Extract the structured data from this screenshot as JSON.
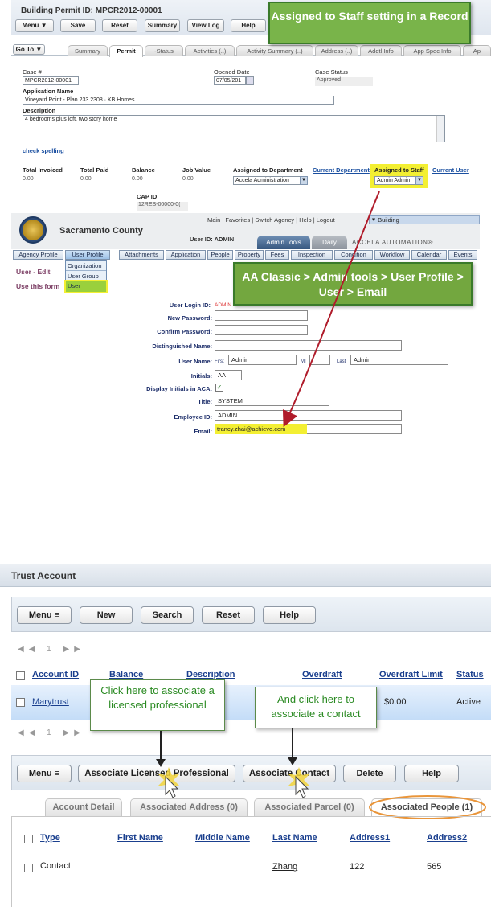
{
  "record": {
    "permit_id": "Building Permit ID: MPCR2012-00001",
    "buttons": [
      "Menu ▼",
      "Save",
      "Reset",
      "Summary",
      "View Log",
      "Help"
    ],
    "goto": "Go To ▼",
    "tabs": [
      "Summary",
      "Permit",
      "-Status",
      "Activities (..)",
      "Activity Summary (..)",
      "Address (..)",
      "Addtl Info",
      "App Spec Info",
      "Ap"
    ],
    "case_label": "Case #",
    "case_value": "MPCR2012-00001",
    "opened_label": "Opened Date",
    "opened_value": "07/05/201",
    "status_label": "Case Status",
    "status_value": "Approved",
    "appname_label": "Application Name",
    "appname_value": "Vineyard Point - Plan 233.2308 · KB Homes",
    "desc_label": "Description",
    "desc_value": "4 bedrooms plus loft, two story home",
    "spell": "check spelling",
    "fin_labels": [
      "Total Invoiced",
      "Total Paid",
      "Balance",
      "Job Value"
    ],
    "fin_values": [
      "0.00",
      "0.00",
      "0.00",
      "0.00"
    ],
    "dept_label": "Assigned to Department",
    "dept_value": "Accela Administration",
    "cur_dept": "Current Department",
    "staff_label": "Assigned to Staff",
    "staff_value": "Admin Admin",
    "cur_user": "Current User",
    "capid_label": "CAP ID",
    "capid_value": "12RES-00000-0("
  },
  "callout1": "Assigned to Staff setting in a Record",
  "classic": {
    "county": "Sacramento County",
    "links": "Main | Favorites | Switch Agency | Help | Logout",
    "building": "Building",
    "userid": "User ID: ADMIN",
    "tab_admin": "Admin Tools",
    "tab_daily": "Daily",
    "brand": "ACCELA AUTOMATION®",
    "menu": [
      "Agency Profile",
      "User Profile",
      "Attachments",
      "Application",
      "People",
      "Property",
      "Fees",
      "Inspection",
      "Condition",
      "Workflow",
      "Calendar",
      "Events"
    ],
    "dropdown": [
      "Organization",
      "User Group",
      "User"
    ],
    "side_title": "User - Edit",
    "side_note": "Use this form",
    "fields": {
      "login_label": "User Login ID:",
      "login_value": "ADMIN",
      "newpw_label": "New Password:",
      "confirm_label": "Confirm Password:",
      "dn_label": "Distinguished Name:",
      "uname_label": "User Name:",
      "first_lbl": "First",
      "first_val": "Admin",
      "mi_lbl": "MI",
      "last_lbl": "Last",
      "last_val": "Admin",
      "initials_label": "Initials:",
      "initials_val": "AA",
      "aca_label": "Display Initials in ACA:",
      "title_label": "Title:",
      "title_val": "SYSTEM",
      "emp_label": "Employee ID:",
      "emp_val": "ADMIN",
      "email_label": "Email:",
      "email_val": "trancy.zhai@achievo.com"
    }
  },
  "callout2": "AA Classic > Admin tools > User Profile > User > Email",
  "trust": {
    "title": "Trust Account",
    "toolbar1": [
      "Menu",
      "New",
      "Search",
      "Reset",
      "Help"
    ],
    "pager": "◀◀ 1 ▶▶",
    "cols": [
      "Account ID",
      "Balance",
      "Description",
      "Overdraft",
      "Overdraft Limit",
      "Status"
    ],
    "row": {
      "id": "Marytrust",
      "limit": "$0.00",
      "status": "Active"
    },
    "toolbar2": [
      "Menu",
      "Associate Licensed Professional",
      "Associate Contact",
      "Delete",
      "Help"
    ],
    "tabs": [
      "Account Detail",
      "Associated Address (0)",
      "Associated Parcel (0)",
      "Associated People (1)"
    ],
    "pcols": [
      "Type",
      "First Name",
      "Middle Name",
      "Last Name",
      "Address1",
      "Address2"
    ],
    "prow": {
      "type": "Contact",
      "last": "Zhang",
      "a1": "122",
      "a2": "565"
    }
  },
  "callout3": "Click here to associate a licensed professional",
  "callout4": "And click here to associate a contact"
}
